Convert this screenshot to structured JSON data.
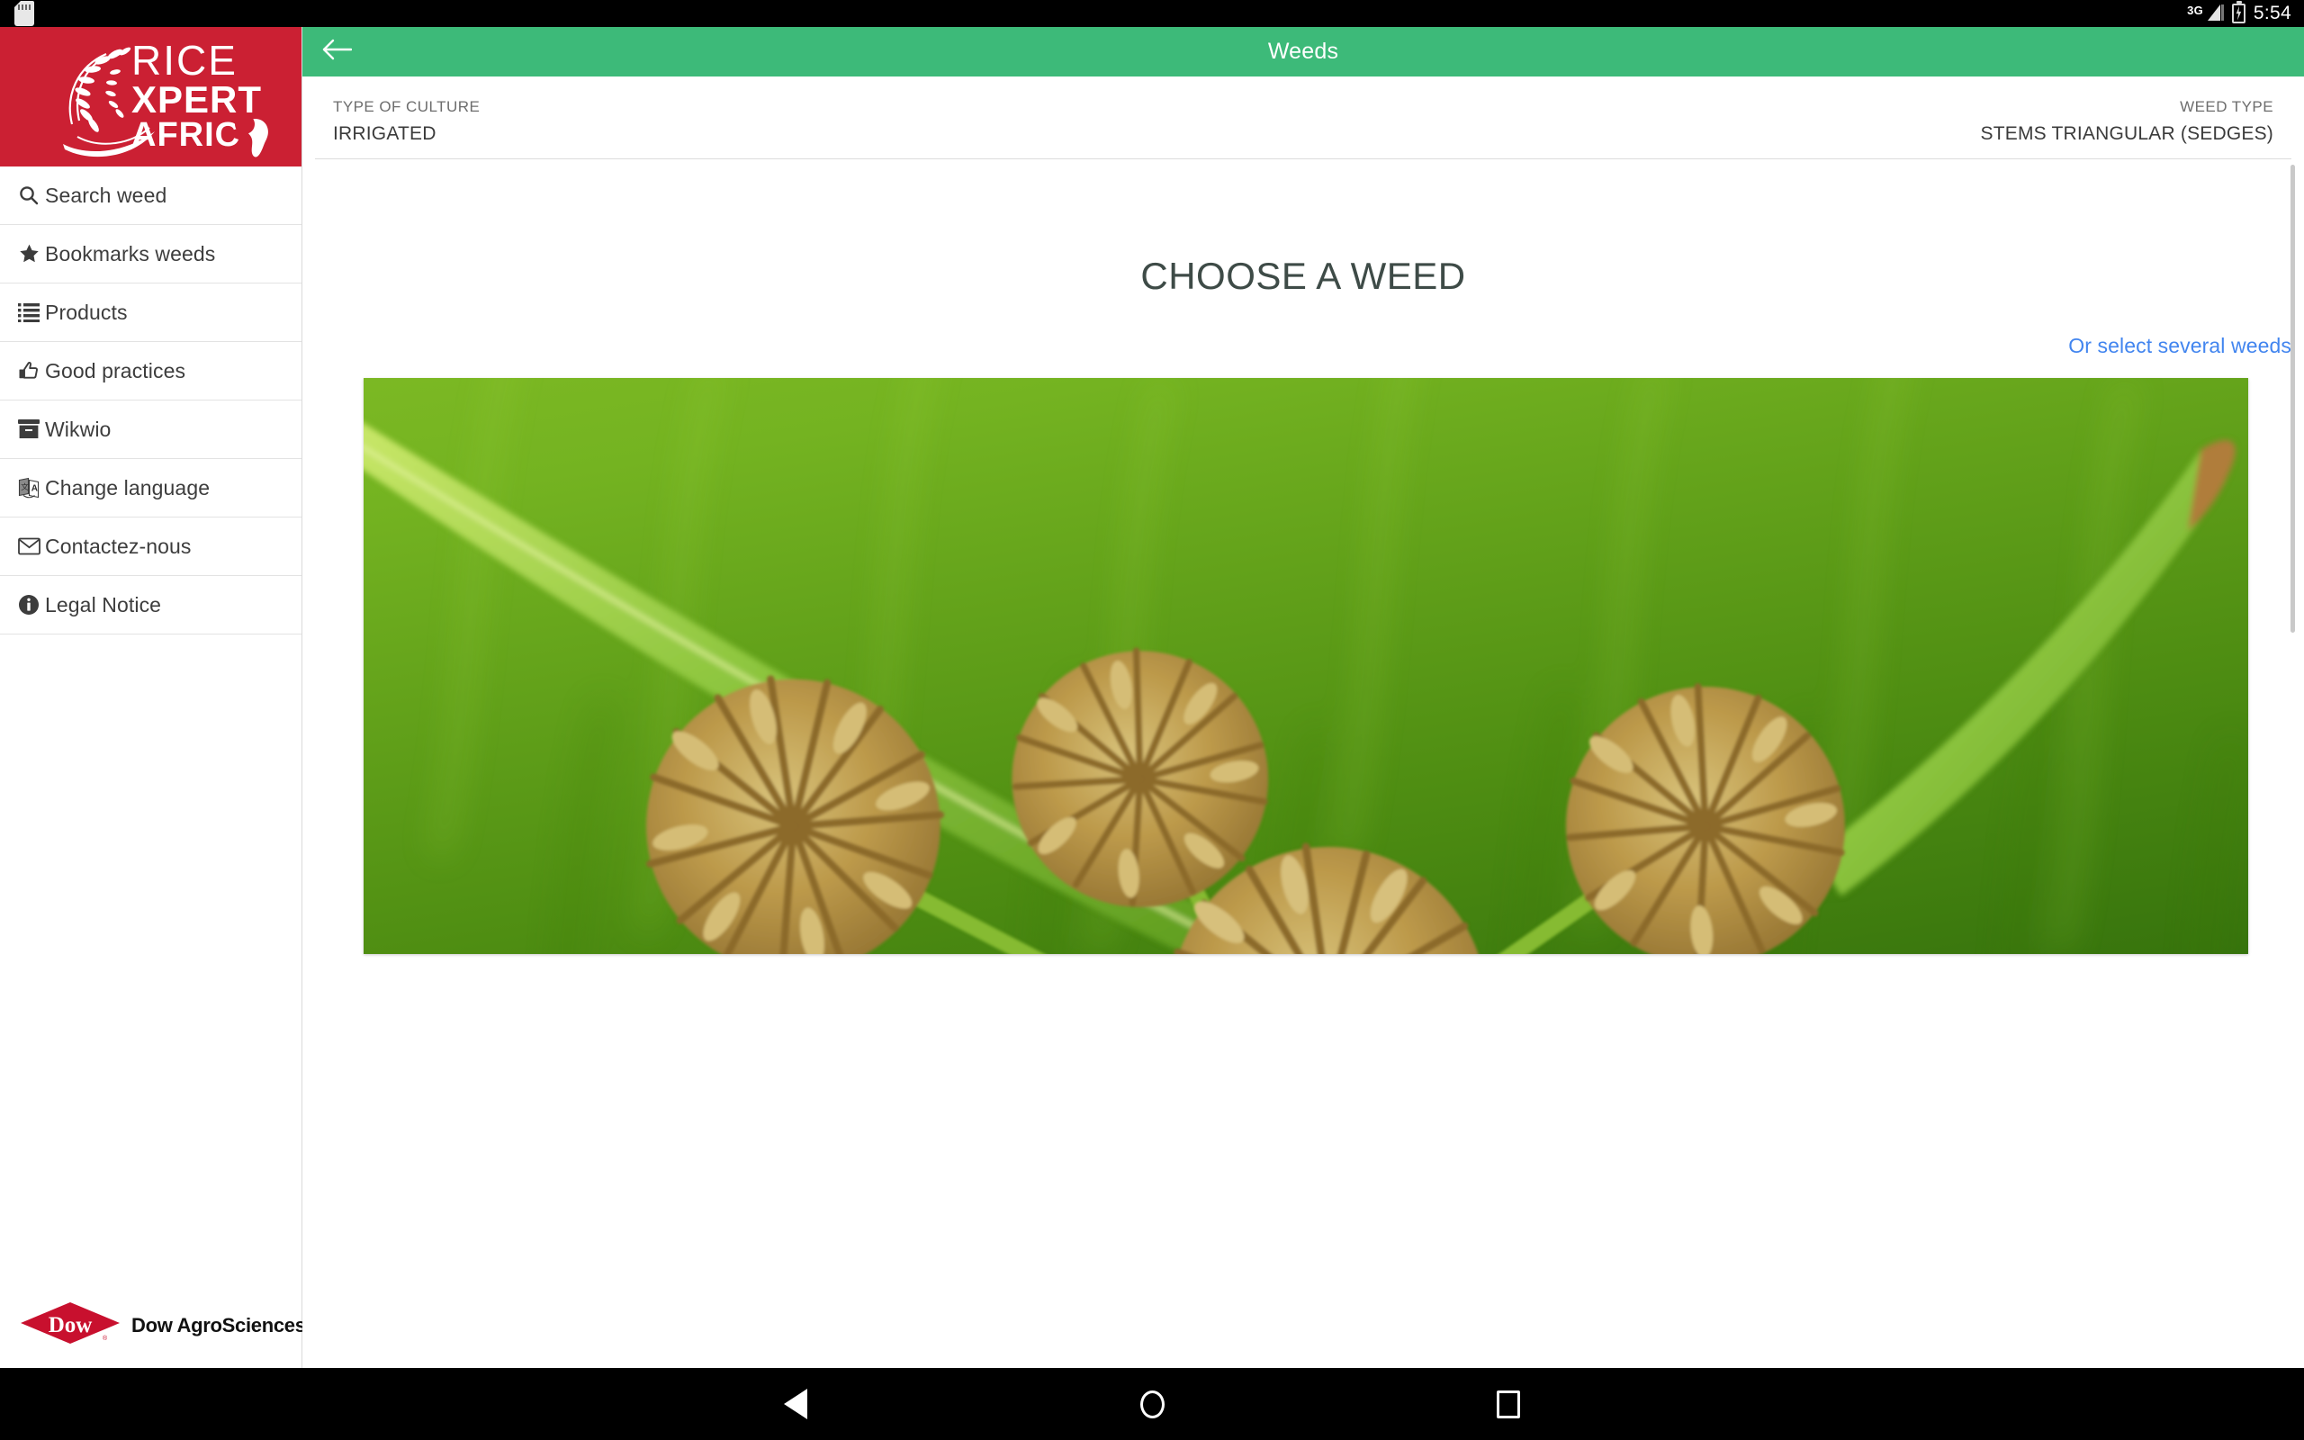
{
  "statusbar": {
    "sd_card_icon": "sd-card-icon",
    "network_label": "3G",
    "signal_icon": "signal-bars-icon",
    "battery_icon": "battery-charging-icon",
    "clock": "5:54"
  },
  "sidebar": {
    "brand": {
      "line1": "RICE",
      "line2": "XPERT",
      "line3": "AFRICA",
      "bg_color": "#cb2033"
    },
    "items": [
      {
        "label": "Search weed",
        "icon": "search-icon"
      },
      {
        "label": "Bookmarks weeds",
        "icon": "star-icon"
      },
      {
        "label": "Products",
        "icon": "list-icon"
      },
      {
        "label": "Good practices",
        "icon": "thumbs-up-icon"
      },
      {
        "label": "Wikwio",
        "icon": "archive-box-icon"
      },
      {
        "label": "Change language",
        "icon": "translate-icon"
      },
      {
        "label": "Contactez-nous",
        "icon": "envelope-icon"
      },
      {
        "label": "Legal Notice",
        "icon": "info-circle-icon"
      }
    ],
    "footer": {
      "logo_text": "Dow",
      "company": "Dow AgroSciences",
      "logo_color": "#c8102e"
    }
  },
  "appbar": {
    "title": "Weeds",
    "back_icon": "arrow-left-icon",
    "bg_color": "#3dba79"
  },
  "info_row": {
    "culture_label": "TYPE OF CULTURE",
    "culture_value": "IRRIGATED",
    "weed_type_label": "WEED TYPE",
    "weed_type_value": "STEMS TRIANGULAR (SEDGES)"
  },
  "main": {
    "page_title": "CHOOSE A WEED",
    "select_several_link": "Or select several weeds",
    "link_color": "#4285ef",
    "weed_photo_alt": "sedge-weed-photo"
  },
  "navbar": {
    "back": "back-button",
    "home": "home-button",
    "recents": "recents-button"
  }
}
